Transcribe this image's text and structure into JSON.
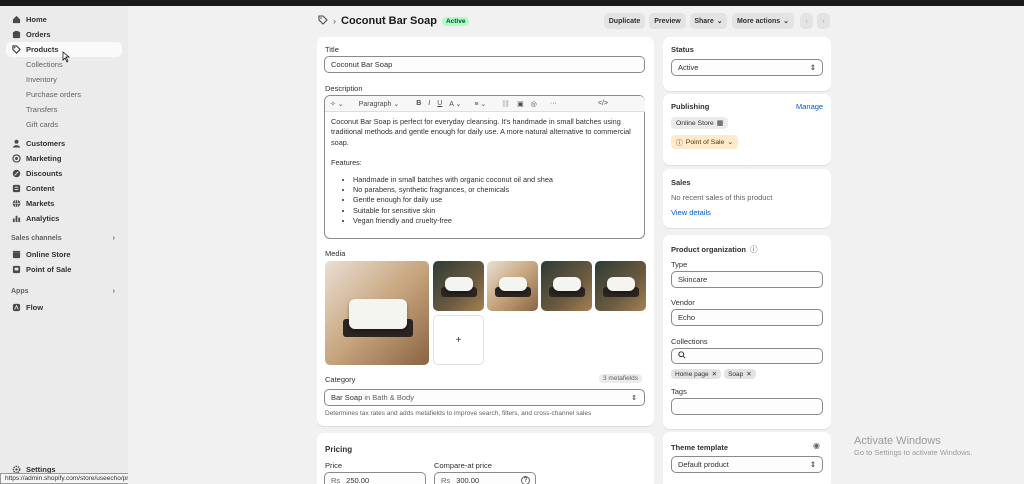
{
  "colors": {
    "accent": "#005bd3",
    "active_badge_bg": "#affebf",
    "sidebar_bg": "#ebebeb"
  },
  "sidebar": {
    "main_items": [
      {
        "label": "Home",
        "icon": "home-icon"
      },
      {
        "label": "Orders",
        "icon": "orders-icon"
      },
      {
        "label": "Products",
        "icon": "tag-icon"
      }
    ],
    "product_sub_items": [
      "Collections",
      "Inventory",
      "Purchase orders",
      "Transfers",
      "Gift cards"
    ],
    "more_items": [
      {
        "label": "Customers",
        "icon": "person-icon"
      },
      {
        "label": "Marketing",
        "icon": "target-icon"
      },
      {
        "label": "Discounts",
        "icon": "discount-icon"
      },
      {
        "label": "Content",
        "icon": "content-icon"
      },
      {
        "label": "Markets",
        "icon": "globe-icon"
      },
      {
        "label": "Analytics",
        "icon": "bar-chart-icon"
      }
    ],
    "sales_channels_label": "Sales channels",
    "sales_channels": [
      {
        "label": "Online Store",
        "icon": "store-icon"
      },
      {
        "label": "Point of Sale",
        "icon": "pos-icon"
      }
    ],
    "apps_label": "Apps",
    "apps": [
      {
        "label": "Flow",
        "icon": "flow-icon"
      }
    ],
    "settings_label": "Settings",
    "status_url": "https://admin.shopify.com/store/useecho/products"
  },
  "header": {
    "title": "Coconut Bar Soap",
    "status_badge": "Active",
    "buttons": {
      "duplicate": "Duplicate",
      "preview": "Preview",
      "share": "Share",
      "more_actions": "More actions"
    }
  },
  "product": {
    "title_label": "Title",
    "title_value": "Coconut Bar Soap",
    "description_label": "Description",
    "editor_paragraph": "Paragraph",
    "description_intro": "Coconut Bar Soap is perfect for everyday cleansing. It's handmade in small batches using traditional methods and gentle enough for daily use. A more natural alternative to commercial soap.",
    "features_label": "Features:",
    "features": [
      "Handmade in small batches with organic coconut oil and shea",
      "No parabens, synthetic fragrances, or chemicals",
      "Gentle enough for daily use",
      "Suitable for sensitive skin",
      "Vegan friendly and cruelty-free"
    ],
    "media_label": "Media",
    "add_media": "+",
    "category_label": "Category",
    "metafields": "3 metafields",
    "category_value_main": "Bar Soap",
    "category_value_sub": " in Bath & Body",
    "category_help": "Determines tax rates and adds metafields to improve search, filters, and cross-channel sales"
  },
  "pricing": {
    "heading": "Pricing",
    "price_label": "Price",
    "price_currency": "Rs",
    "price_value": "250.00",
    "compare_label": "Compare-at price",
    "compare_currency": "Rs",
    "compare_value": "300.00"
  },
  "status_card": {
    "heading": "Status",
    "value": "Active"
  },
  "publishing": {
    "heading": "Publishing",
    "manage": "Manage",
    "online_store": "Online Store",
    "pos": "Point of Sale"
  },
  "sales": {
    "heading": "Sales",
    "text": "No recent sales of this product",
    "link": "View details"
  },
  "organization": {
    "heading": "Product organization",
    "type_label": "Type",
    "type_value": "Skincare",
    "vendor_label": "Vendor",
    "vendor_value": "Echo",
    "collections_label": "Collections",
    "collection_tags": [
      "Home page",
      "Soap"
    ],
    "tags_label": "Tags"
  },
  "theme": {
    "heading": "Theme template",
    "value": "Default product"
  },
  "watermark": {
    "line1": "Activate Windows",
    "line2": "Go to Settings to activate Windows."
  }
}
